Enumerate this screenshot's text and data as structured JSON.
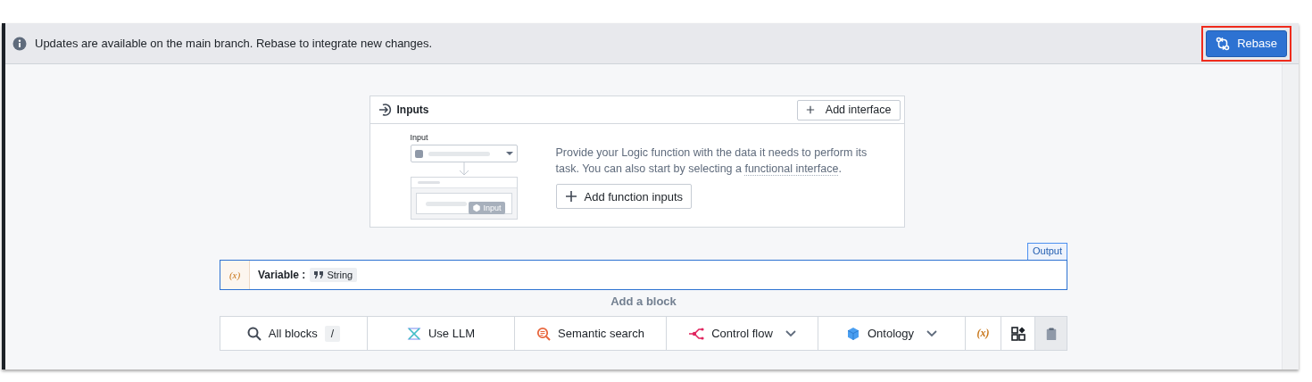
{
  "banner": {
    "message": "Updates are available on the main branch. Rebase to integrate new changes.",
    "button": "Rebase",
    "highlighted": true
  },
  "inputs_panel": {
    "title": "Inputs",
    "add_interface": "Add interface",
    "illustration": {
      "label": "Input",
      "chip": "Input"
    },
    "description": "Provide your Logic function with the data it needs to perform its task. You can also start by selecting a ",
    "link": "functional interface",
    "description_end": ".",
    "add_button": "Add function inputs"
  },
  "output_tab": "Output",
  "variable": {
    "icon": "(x)",
    "label": "Variable",
    "separator": ":",
    "type": "String"
  },
  "add_block": "Add a block",
  "toolbar": [
    {
      "kind": "search",
      "label": "All blocks",
      "shortcut": "/",
      "dropdown": false,
      "disabled": false
    },
    {
      "kind": "llm",
      "label": "Use LLM",
      "dropdown": false,
      "disabled": false
    },
    {
      "kind": "semantic",
      "label": "Semantic search",
      "dropdown": false,
      "disabled": false
    },
    {
      "kind": "flow",
      "label": "Control flow",
      "dropdown": true,
      "disabled": false
    },
    {
      "kind": "ontology",
      "label": "Ontology",
      "dropdown": true,
      "disabled": false
    },
    {
      "kind": "variable",
      "label": "(x)",
      "dropdown": false,
      "disabled": false
    },
    {
      "kind": "grid",
      "dropdown": false,
      "disabled": false
    },
    {
      "kind": "clipboard",
      "dropdown": false,
      "disabled": true
    }
  ]
}
